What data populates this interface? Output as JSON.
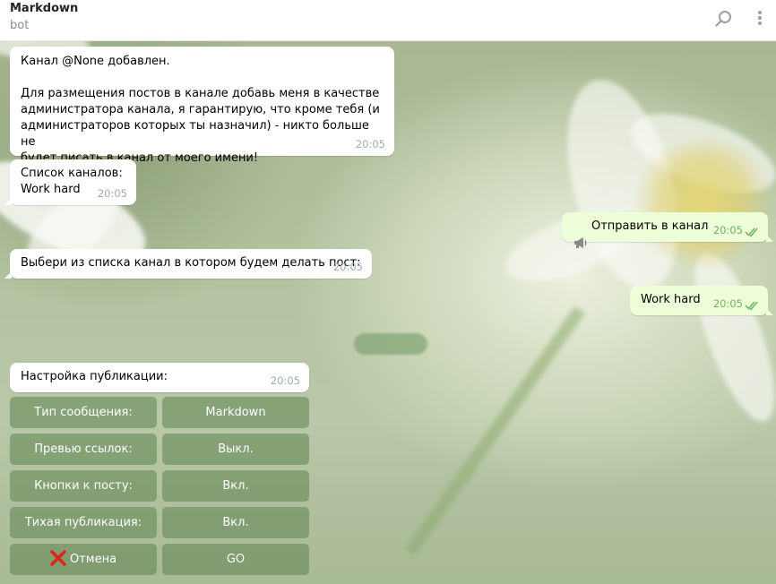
{
  "header": {
    "title": "Markdown",
    "subtitle": "bot",
    "search_icon": "search-icon",
    "menu_icon": "more-vertical-icon"
  },
  "messages": [
    {
      "direction": "in",
      "text": "Канал @None добавлен.\n\nДля размещения постов в канале добавь меня в качестве\nадминистратора канала, я гарантирую, что кроме тебя (и\nадминистраторов которых ты назначил) - никто больше не\nбудет писать в канал от моего имени!",
      "time": "20:05"
    },
    {
      "direction": "in",
      "text": "Список каналов:\n   Work hard",
      "time": "20:05"
    },
    {
      "direction": "out",
      "icon": "megaphone-icon",
      "text": "Отправить в канал",
      "time": "20:05",
      "status": "read"
    },
    {
      "direction": "in",
      "text": "Выбери из списка канал в котором будем делать пост:",
      "time": "20:05"
    },
    {
      "direction": "out",
      "text": "Work hard",
      "time": "20:05",
      "status": "read"
    },
    {
      "direction": "in",
      "text": "Настройка публикации:",
      "time": "20:05"
    }
  ],
  "keyboard": [
    [
      "Тип сообщения:",
      "Markdown"
    ],
    [
      "Превью ссылок:",
      "Выкл."
    ],
    [
      "Кнопки к посту:",
      "Вкл."
    ],
    [
      "Тихая публикация:",
      "Вкл."
    ],
    [
      "Отмена",
      "GO"
    ]
  ],
  "colors": {
    "incoming_bubble": "#ffffff",
    "outgoing_bubble": "#eefed9",
    "read_check": "#6fb560",
    "keyboard_button": "#5f8450",
    "cancel_icon": "#e0241b"
  }
}
